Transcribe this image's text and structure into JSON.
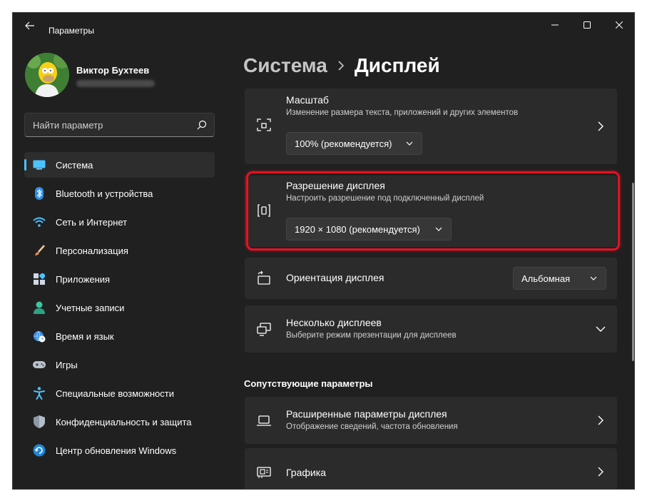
{
  "window": {
    "title": "Параметры",
    "controls": [
      "minimize",
      "maximize",
      "close"
    ]
  },
  "user": {
    "name": "Виктор Бухтеев"
  },
  "search": {
    "placeholder": "Найти параметр"
  },
  "sidebar": {
    "items": [
      {
        "label": "Система",
        "icon": "display-icon",
        "active": true
      },
      {
        "label": "Bluetooth и устройства",
        "icon": "bluetooth-icon"
      },
      {
        "label": "Сеть и Интернет",
        "icon": "wifi-icon"
      },
      {
        "label": "Персонализация",
        "icon": "brush-icon"
      },
      {
        "label": "Приложения",
        "icon": "apps-icon"
      },
      {
        "label": "Учетные записи",
        "icon": "person-icon"
      },
      {
        "label": "Время и язык",
        "icon": "globe-clock-icon"
      },
      {
        "label": "Игры",
        "icon": "gamepad-icon"
      },
      {
        "label": "Специальные возможности",
        "icon": "accessibility-icon"
      },
      {
        "label": "Конфиденциальность и защита",
        "icon": "shield-icon"
      },
      {
        "label": "Центр обновления Windows",
        "icon": "update-icon"
      }
    ]
  },
  "breadcrumb": {
    "parent": "Система",
    "current": "Дисплей"
  },
  "settings": {
    "scale": {
      "title": "Масштаб",
      "subtitle": "Изменение размера текста, приложений и других элементов",
      "value": "100% (рекомендуется)"
    },
    "resolution": {
      "title": "Разрешение дисплея",
      "subtitle": "Настроить разрешение под подключенный дисплей",
      "value": "1920 × 1080 (рекомендуется)"
    },
    "orientation": {
      "title": "Ориентация дисплея",
      "value": "Альбомная"
    },
    "multiple": {
      "title": "Несколько дисплеев",
      "subtitle": "Выберите режим презентации для дисплеев"
    }
  },
  "related": {
    "heading": "Сопутствующие параметры",
    "advanced": {
      "title": "Расширенные параметры дисплея",
      "subtitle": "Отображение сведений, частота обновления"
    },
    "graphics": {
      "title": "Графика"
    }
  },
  "colors": {
    "accent": "#4cc2ff",
    "highlight": "#e81123",
    "background": "#202020",
    "card": "#2b2b2b"
  }
}
